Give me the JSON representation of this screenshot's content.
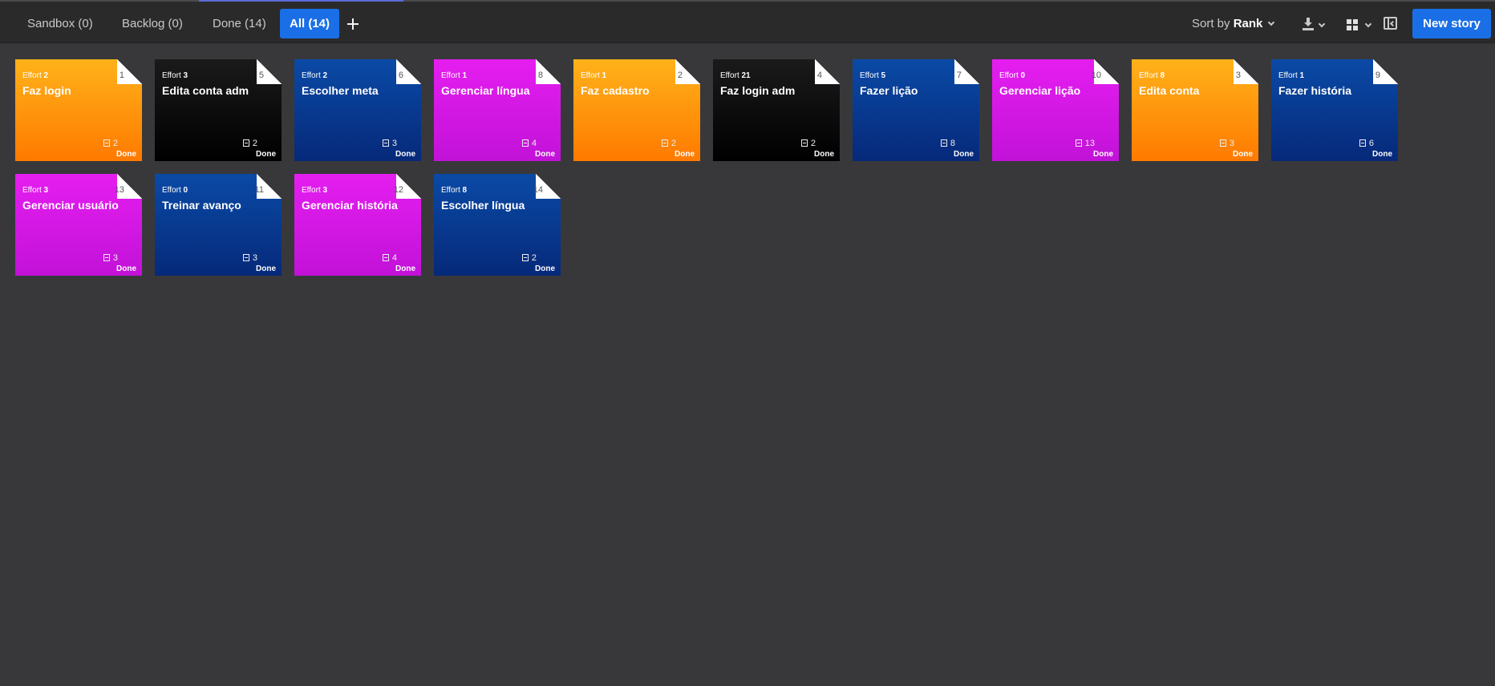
{
  "tabs": [
    {
      "label": "Sandbox (0)"
    },
    {
      "label": "Backlog (0)"
    },
    {
      "label": "Done (14)"
    },
    {
      "label": "All (14)"
    }
  ],
  "toolbar": {
    "sort_prefix": "Sort by",
    "sort_value": "Rank",
    "new_story_label": "New story",
    "icons": [
      "add-tab-icon",
      "download-icon",
      "grid-view-icon",
      "side-panel-icon"
    ]
  },
  "colors": {
    "accent": "#1a6fe6",
    "background": "#38383b",
    "card_orange": "#ff9a0d",
    "card_black": "#0a0a0a",
    "card_blue": "#083a90",
    "card_magenta": "#d818e4"
  },
  "effort_label": "Effort",
  "cards": [
    {
      "number": "1",
      "effort": "2",
      "title": "Faz login",
      "tasks": "2",
      "status": "Done",
      "color": "orange"
    },
    {
      "number": "5",
      "effort": "3",
      "title": "Edita conta adm",
      "tasks": "2",
      "status": "Done",
      "color": "black"
    },
    {
      "number": "6",
      "effort": "2",
      "title": "Escolher meta",
      "tasks": "3",
      "status": "Done",
      "color": "blue"
    },
    {
      "number": "8",
      "effort": "1",
      "title": "Gerenciar língua",
      "tasks": "4",
      "status": "Done",
      "color": "magenta"
    },
    {
      "number": "2",
      "effort": "1",
      "title": "Faz cadastro",
      "tasks": "2",
      "status": "Done",
      "color": "orange"
    },
    {
      "number": "4",
      "effort": "21",
      "title": "Faz login adm",
      "tasks": "2",
      "status": "Done",
      "color": "black"
    },
    {
      "number": "7",
      "effort": "5",
      "title": "Fazer lição",
      "tasks": "8",
      "status": "Done",
      "color": "blue"
    },
    {
      "number": "10",
      "effort": "0",
      "title": "Gerenciar lição",
      "tasks": "13",
      "status": "Done",
      "color": "magenta"
    },
    {
      "number": "3",
      "effort": "8",
      "title": "Edita conta",
      "tasks": "3",
      "status": "Done",
      "color": "orange"
    },
    {
      "number": "9",
      "effort": "1",
      "title": "Fazer história",
      "tasks": "6",
      "status": "Done",
      "color": "blue"
    },
    {
      "number": "13",
      "effort": "3",
      "title": "Gerenciar usuário",
      "tasks": "3",
      "status": "Done",
      "color": "magenta"
    },
    {
      "number": "11",
      "effort": "0",
      "title": "Treinar avanço",
      "tasks": "3",
      "status": "Done",
      "color": "blue"
    },
    {
      "number": "12",
      "effort": "3",
      "title": "Gerenciar história",
      "tasks": "4",
      "status": "Done",
      "color": "magenta"
    },
    {
      "number": "14",
      "effort": "8",
      "title": "Escolher língua",
      "tasks": "2",
      "status": "Done",
      "color": "blue"
    }
  ]
}
